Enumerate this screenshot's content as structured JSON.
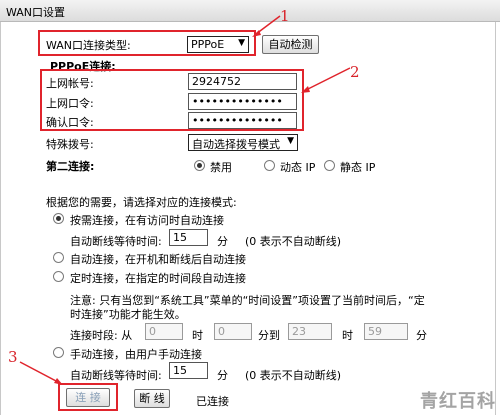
{
  "header": {
    "title": "WAN口设置"
  },
  "wan_type": {
    "label": "WAN口连接类型:",
    "value": "PPPoE",
    "detect_button": "自动检测"
  },
  "pppoe": {
    "section_label": "PPPoE连接:",
    "account_label": "上网帐号:",
    "account_value": "2924752",
    "password_label": "上网口令:",
    "password_value": "••••••••••••••",
    "confirm_label": "确认口令:",
    "confirm_value": "••••••••••••••",
    "dial_label": "特殊拨号:",
    "dial_value": "自动选择拨号模式"
  },
  "second_conn": {
    "label": "第二连接:",
    "options": [
      "禁用",
      "动态 IP",
      "静态 IP"
    ],
    "selected": 0
  },
  "modes": {
    "intro": "根据您的需要，请选择对应的连接模式:",
    "on_demand": {
      "label": "按需连接，在有访问时自动连接",
      "wait_label": "自动断线等待时间:",
      "wait_value": "15",
      "wait_unit": "分",
      "wait_note": "(0 表示不自动断线)"
    },
    "auto": {
      "label": "自动连接，在开机和断线后自动连接"
    },
    "timed": {
      "label": "定时连接，在指定的时间段自动连接",
      "note_line1": "注意: 只有当您到“系统工具”菜单的“时间设置”项设置了当前时间后，“定",
      "note_line2": "时连接”功能才能生效。",
      "period_label": "连接时段: 从",
      "from_hour": "0",
      "hour_unit": "时",
      "from_min": "0",
      "to_label": "分到",
      "to_hour": "23",
      "to_min": "59",
      "min_unit": "分"
    },
    "manual": {
      "label": "手动连接，由用户手动连接",
      "wait_label": "自动断线等待时间:",
      "wait_value": "15",
      "wait_unit": "分",
      "wait_note": "(0 表示不自动断线)"
    }
  },
  "actions": {
    "connect": "连 接",
    "disconnect": "断 线",
    "status": "已连接"
  },
  "annotations": {
    "one": "1",
    "two": "2",
    "three": "3"
  },
  "watermark": "青红百科",
  "colors": {
    "annotation_red": "#e0242c"
  }
}
